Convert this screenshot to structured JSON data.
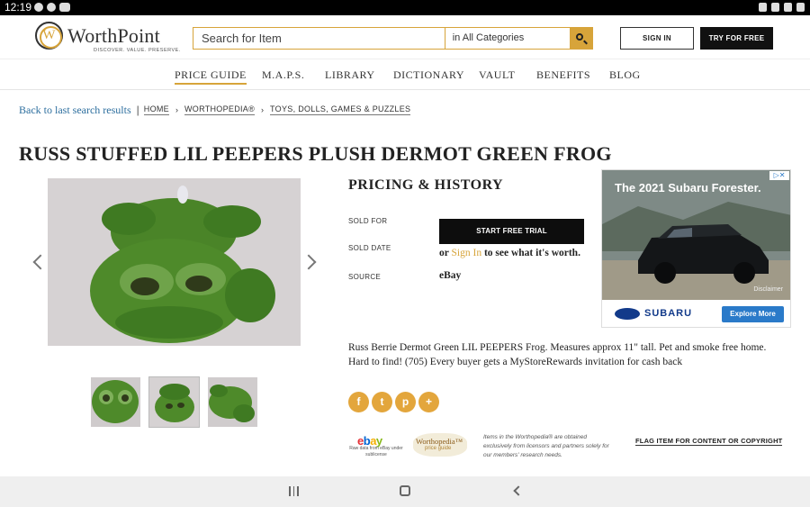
{
  "status_bar": {
    "time": "12:19"
  },
  "header": {
    "logo_letter": "W",
    "logo_text": "WorthPoint",
    "tagline": "DISCOVER. VALUE. PRESERVE.",
    "search_placeholder": "Search for Item",
    "category": "in All Categories",
    "signin_label": "SIGN IN",
    "try_label": "TRY FOR FREE"
  },
  "nav": {
    "items": [
      "PRICE GUIDE",
      "M.A.P.S.",
      "LIBRARY",
      "DICTIONARY",
      "VAULT",
      "BENEFITS",
      "BLOG"
    ],
    "active": "PRICE GUIDE"
  },
  "breadcrumb": {
    "back": "Back to last search results",
    "items": [
      "HOME",
      "WORTHOPEDIA®",
      "TOYS, DOLLS, GAMES & PUZZLES"
    ]
  },
  "item": {
    "title": "RUSS STUFFED LIL PEEPERS PLUSH DERMOT GREEN FROG",
    "description": "Russ Berrie Dermot Green LIL PEEPERS Frog. Measures approx 11\" tall. Pet and smoke free home. Hard to find! (705) Every buyer gets a MyStoreRewards invitation for cash back"
  },
  "pricing": {
    "title": "PRICING & HISTORY",
    "sold_for_label": "SOLD FOR",
    "sold_date_label": "SOLD DATE",
    "source_label": "SOURCE",
    "trial_button": "START FREE TRIAL",
    "signin_prefix": "or",
    "signin_link": "Sign In",
    "signin_suffix": "to see what it's worth.",
    "source_value": "eBay"
  },
  "ad": {
    "headline": "The 2021 Subaru Forester.",
    "adchoice": "▷✕",
    "disclaimer": "Disclaimer",
    "brand": "SUBARU",
    "cta": "Explore More"
  },
  "share": [
    "f",
    "t",
    "p",
    "+"
  ],
  "footer": {
    "ebay_letters": [
      "e",
      "b",
      "a",
      "y"
    ],
    "ebay_caption": "Raw data from eBay under sublicense",
    "worthopedia_name": "Worthopedia™",
    "worthopedia_sub": "price guide",
    "disclaimer": "Items in the Worthopedia® are obtained exclusively from licensors and partners solely for our members' research needs.",
    "flag_link": "FLAG ITEM FOR CONTENT OR COPYRIGHT"
  },
  "colors": {
    "accent_gold": "#d7a43a",
    "link_blue": "#2c6e9e",
    "share_orange": "#e3a63c",
    "frog_green": "#4e8a2a"
  }
}
